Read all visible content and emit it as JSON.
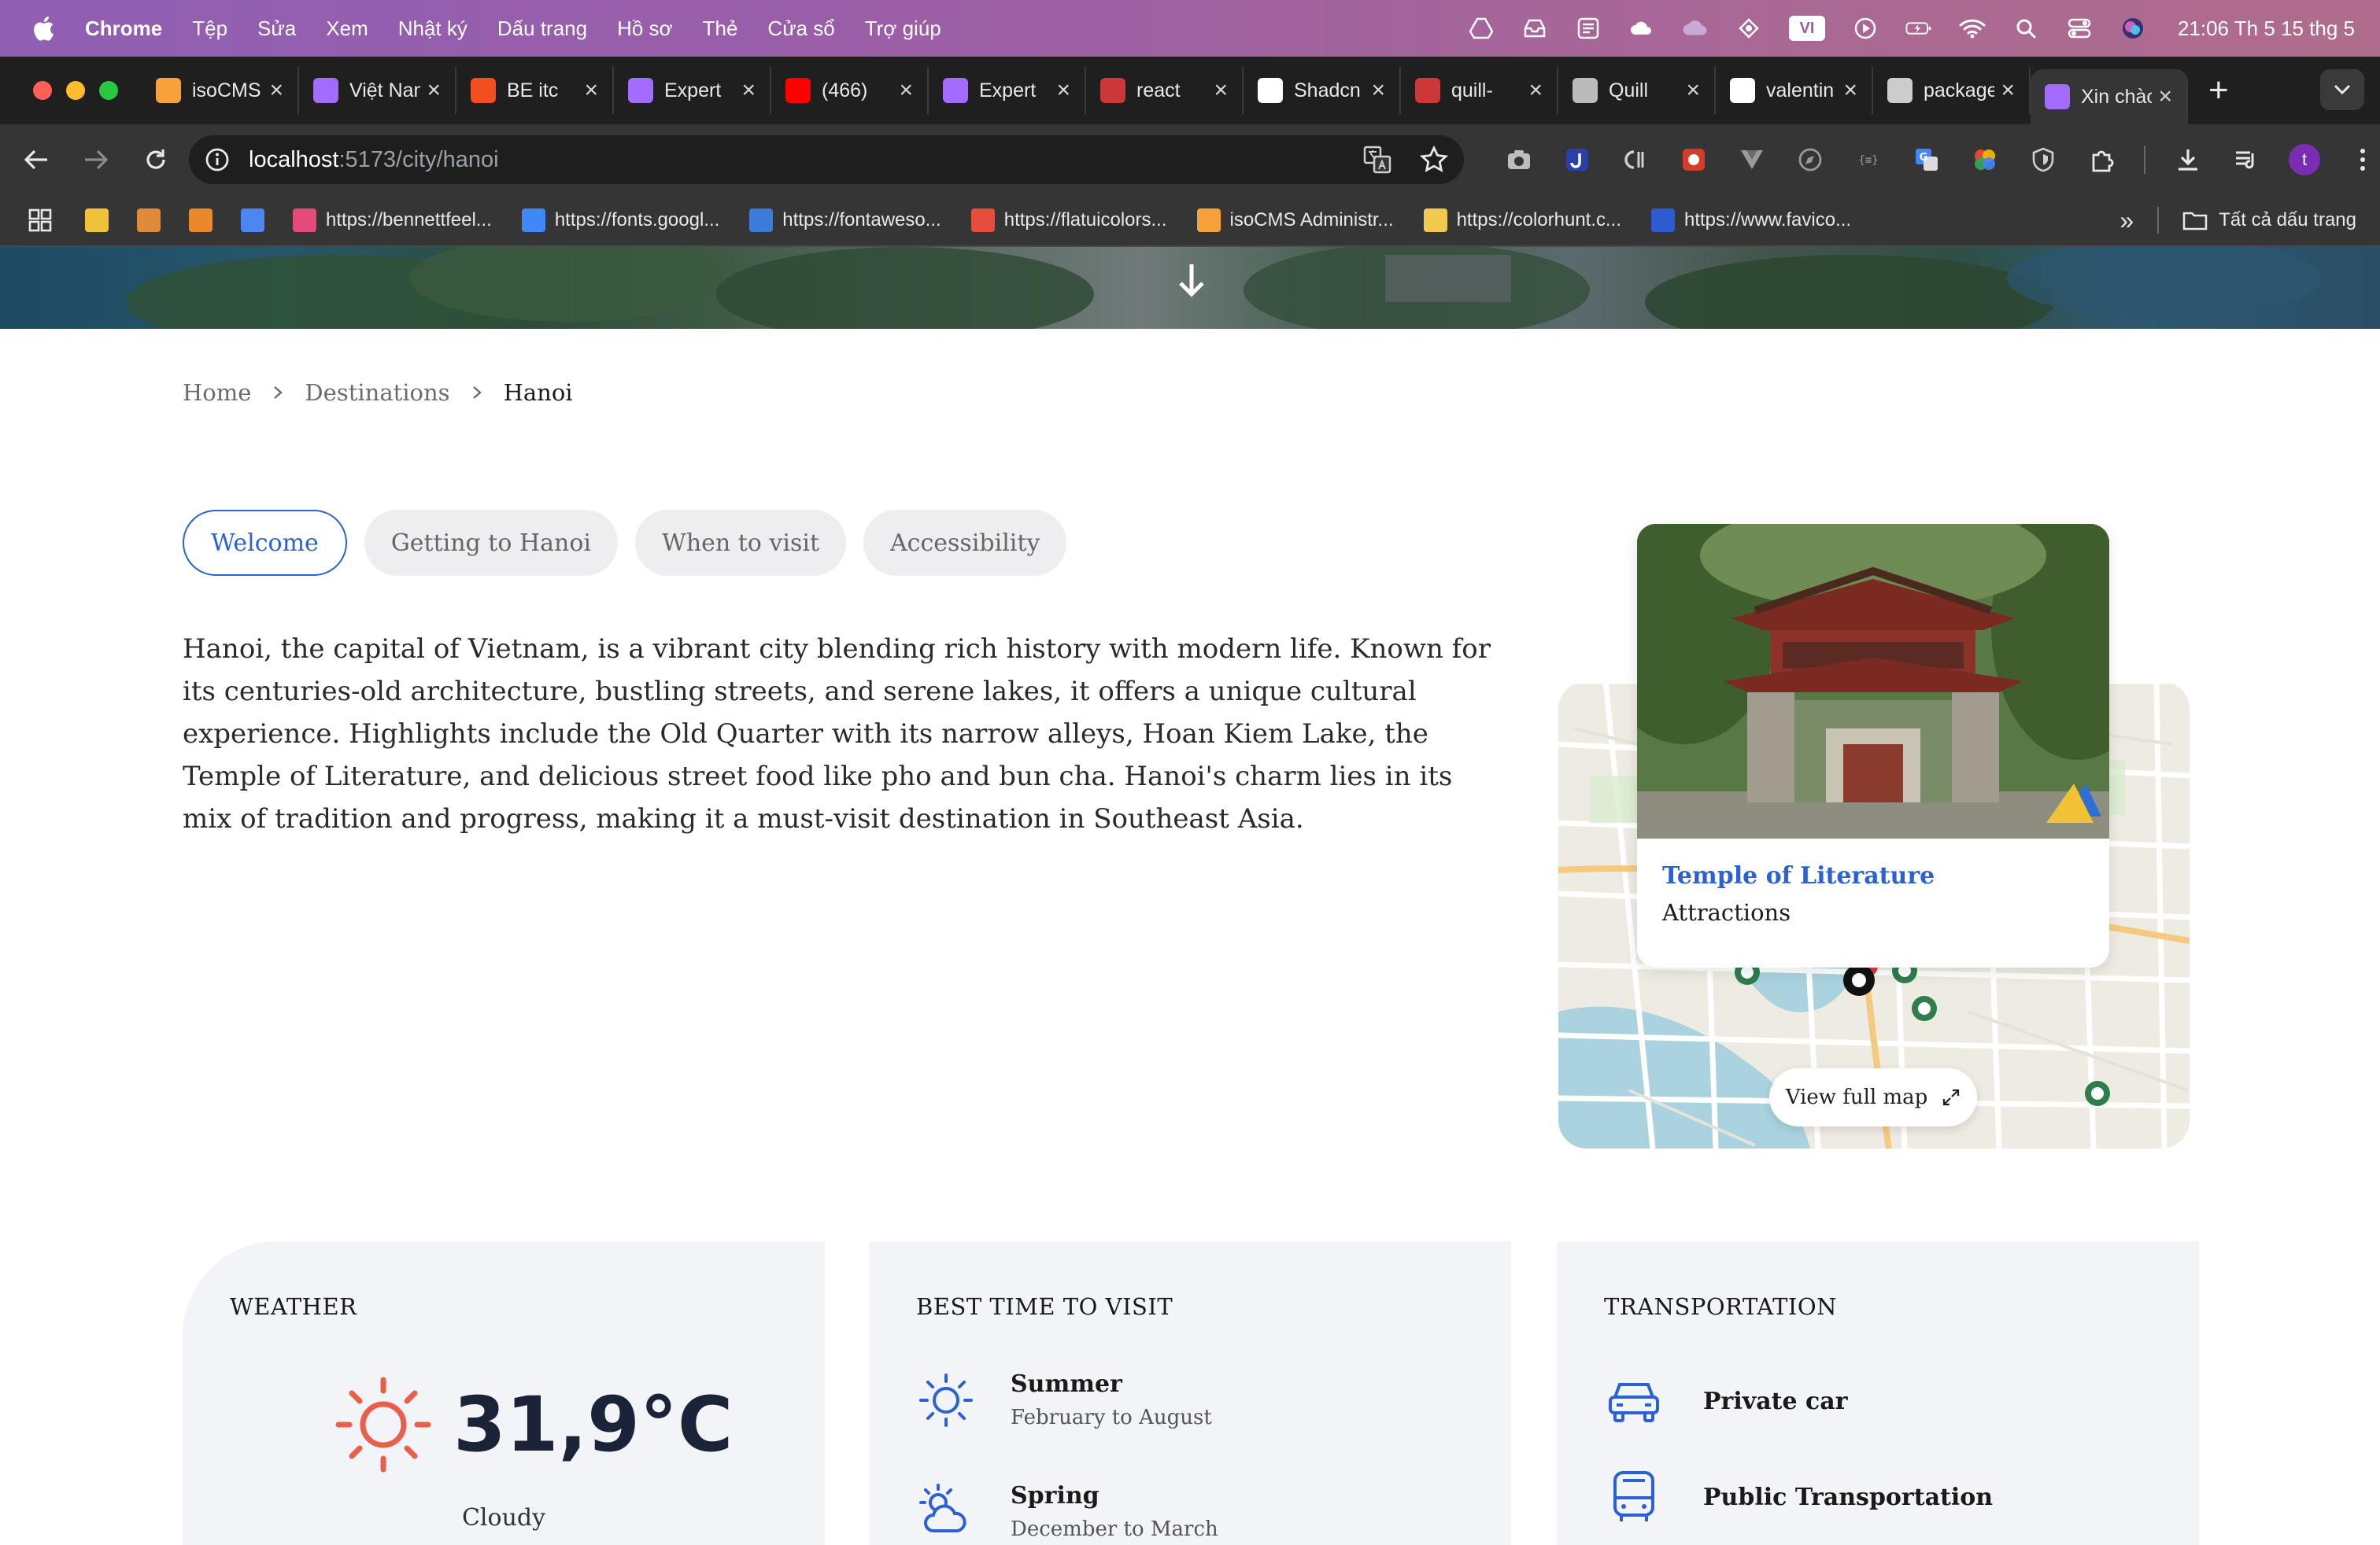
{
  "menubar": {
    "app": "Chrome",
    "items": [
      "Tệp",
      "Sửa",
      "Xem",
      "Nhật ký",
      "Dấu trang",
      "Hồ sơ",
      "Thẻ",
      "Cửa sổ",
      "Trợ giúp"
    ],
    "input_badge": "VI",
    "clock": "21:06 Th 5 15 thg 5"
  },
  "tabs": [
    {
      "title": "isoCMS",
      "favicon": "isocms-icon",
      "color": "#f6a13a"
    },
    {
      "title": "Việt Nam",
      "favicon": "vite-icon",
      "color": "#a46bff"
    },
    {
      "title": "BE itc",
      "favicon": "figma-icon",
      "color": "#f24e1e"
    },
    {
      "title": "Expert",
      "favicon": "vite-icon",
      "color": "#a46bff"
    },
    {
      "title": "(466)",
      "favicon": "youtube-icon",
      "color": "#ff0000"
    },
    {
      "title": "Expert",
      "favicon": "vite-icon",
      "color": "#a46bff"
    },
    {
      "title": "react",
      "favicon": "npm-icon",
      "color": "#cb3837"
    },
    {
      "title": "Shadcn",
      "favicon": "chatgpt-icon",
      "color": "#ffffff"
    },
    {
      "title": "quill-",
      "favicon": "npm-icon",
      "color": "#cb3837"
    },
    {
      "title": "Quill",
      "favicon": "globe-icon",
      "color": "#bbbbbb"
    },
    {
      "title": "valentin",
      "favicon": "github-icon",
      "color": "#ffffff"
    },
    {
      "title": "packages",
      "favicon": "page-icon",
      "color": "#cccccc"
    },
    {
      "title": "Xin chào",
      "favicon": "vite-icon",
      "color": "#a46bff",
      "active": true
    }
  ],
  "address": {
    "host": "localhost",
    "path": ":5173/city/hanoi"
  },
  "bookmarks": [
    {
      "label": "",
      "color": "#f0c23a"
    },
    {
      "label": "",
      "color": "#e08a3c"
    },
    {
      "label": "",
      "color": "#e9892a"
    },
    {
      "label": "",
      "color": "#4d86f0"
    },
    {
      "label": "https://bennettfeel...",
      "color": "#e64a7a"
    },
    {
      "label": "https://fonts.googl...",
      "color": "#3f88f5"
    },
    {
      "label": "https://fontaweso...",
      "color": "#3b7bd9"
    },
    {
      "label": "https://flatuicolors...",
      "color": "#e74c3c"
    },
    {
      "label": "isoCMS Administr...",
      "color": "#f6a13a"
    },
    {
      "label": "https://colorhunt.c...",
      "color": "#f2c94c"
    },
    {
      "label": "https://www.favico...",
      "color": "#2d5bd1"
    }
  ],
  "bookmarks_all": "Tất cả dấu trang",
  "breadcrumb": {
    "home": "Home",
    "destinations": "Destinations",
    "current": "Hanoi"
  },
  "content_tabs": [
    "Welcome",
    "Getting to Hanoi",
    "When to visit",
    "Accessibility"
  ],
  "intro": "Hanoi, the capital of Vietnam, is a vibrant city blending rich history with modern life. Known for its centuries-old architecture, bustling streets, and serene lakes, it offers a unique cultural experience. Highlights include the Old Quarter with its narrow alleys, Hoan Kiem Lake, the Temple of Literature, and delicious street food like pho and bun cha. Hanoi's charm lies in its mix of tradition and progress, making it a must-visit destination in Southeast Asia.",
  "map": {
    "place_name": "Temple of Literature",
    "place_category": "Attractions",
    "view_full_map": "View full map"
  },
  "weather": {
    "title": "WEATHER",
    "temperature": "31,9°C",
    "condition": "Cloudy",
    "icon": "sun-icon"
  },
  "best_time": {
    "title": "BEST TIME TO VISIT",
    "seasons": [
      {
        "name": "Summer",
        "dates": "February to August",
        "icon": "sun-outline-icon"
      },
      {
        "name": "Spring",
        "dates": "December to March",
        "icon": "partly-cloudy-icon"
      }
    ]
  },
  "transportation": {
    "title": "TRANSPORTATION",
    "options": [
      {
        "name": "Private car",
        "icon": "car-icon"
      },
      {
        "name": "Public Transportation",
        "icon": "bus-icon"
      }
    ]
  },
  "colors": {
    "accent": "#2a62d6",
    "weather_sun": "#e8604c",
    "card_bg": "#f3f4f8"
  }
}
